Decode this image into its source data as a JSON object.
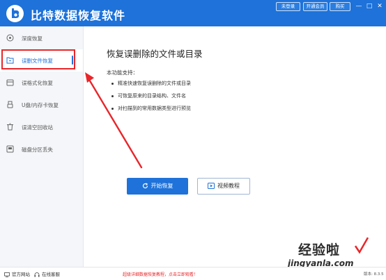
{
  "app": {
    "title": "比特数据恢复软件"
  },
  "titlebar": {
    "login_label": "未登录",
    "vip_label": "开通会员",
    "buy_label": "购买"
  },
  "sidebar": {
    "items": [
      {
        "label": "深度恢复",
        "icon": "deep-scan-icon"
      },
      {
        "label": "误删文件恢复",
        "icon": "file-delete-icon",
        "active": true
      },
      {
        "label": "误格式化恢复",
        "icon": "format-icon"
      },
      {
        "label": "U盘/内存卡恢复",
        "icon": "usb-icon"
      },
      {
        "label": "误清空回收站",
        "icon": "recycle-bin-icon"
      },
      {
        "label": "磁盘分区丢失",
        "icon": "disk-icon"
      }
    ]
  },
  "main": {
    "title": "恢复误删除的文件或目录",
    "support_label": "本功能支持：",
    "features": [
      "精准快速恢复误删除的文件或目录",
      "可恢复原来的目录结构、文件名",
      "对扫描到的常用数据类型进行预览"
    ],
    "start_button": "开始恢复",
    "video_button": "视频教程"
  },
  "footer": {
    "website": "官方网站",
    "service": "在线客服",
    "promo": "超级详细数据恢复教程，点击立即观看！",
    "version": "版本: 8.3.5"
  },
  "watermark": {
    "cn": "经验啦",
    "en": "jingyanla.com"
  },
  "colors": {
    "primary": "#1e72d9",
    "highlight_red": "#e8262a",
    "sidebar_bg": "#f4f6f9"
  }
}
